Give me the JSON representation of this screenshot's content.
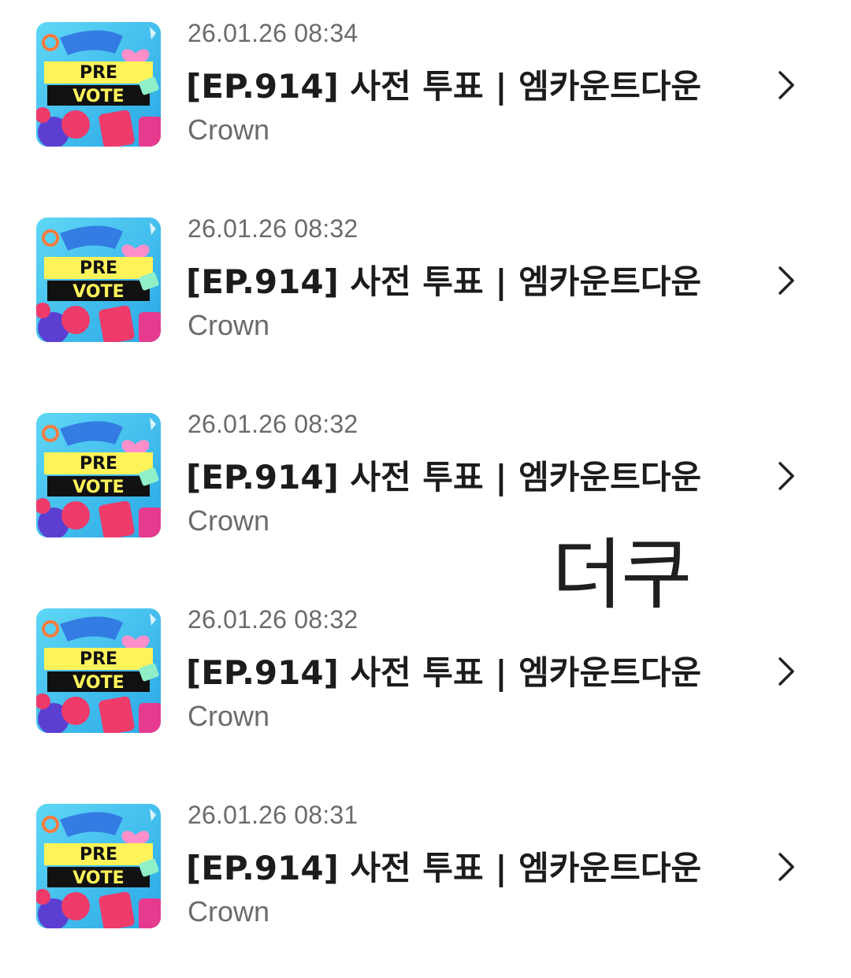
{
  "items": [
    {
      "date": "26.01.26 08:34",
      "title": "[EP.914] 사전 투표 | 엠카운트다운",
      "channel": "Crown",
      "thumb_line1": "PRE",
      "thumb_line2": "VOTE"
    },
    {
      "date": "26.01.26 08:32",
      "title": "[EP.914] 사전 투표 | 엠카운트다운",
      "channel": "Crown",
      "thumb_line1": "PRE",
      "thumb_line2": "VOTE"
    },
    {
      "date": "26.01.26 08:32",
      "title": "[EP.914] 사전 투표 | 엠카운트다운",
      "channel": "Crown",
      "thumb_line1": "PRE",
      "thumb_line2": "VOTE"
    },
    {
      "date": "26.01.26 08:32",
      "title": "[EP.914] 사전 투표 | 엠카운트다운",
      "channel": "Crown",
      "thumb_line1": "PRE",
      "thumb_line2": "VOTE"
    },
    {
      "date": "26.01.26 08:31",
      "title": "[EP.914] 사전 투표 | 엠카운트다운",
      "channel": "Crown",
      "thumb_line1": "PRE",
      "thumb_line2": "VOTE"
    }
  ],
  "watermark": "더쿠",
  "icons": {
    "row_action": "chevron-right-icon"
  },
  "colors": {
    "thumb_bg": "#3fc4ee",
    "thumb_banner": "#fff35a",
    "thumb_dark": "#111111",
    "heart": "#ff8fcb",
    "accent_red": "#ee3b6a",
    "accent_purple": "#5b3fd1"
  }
}
